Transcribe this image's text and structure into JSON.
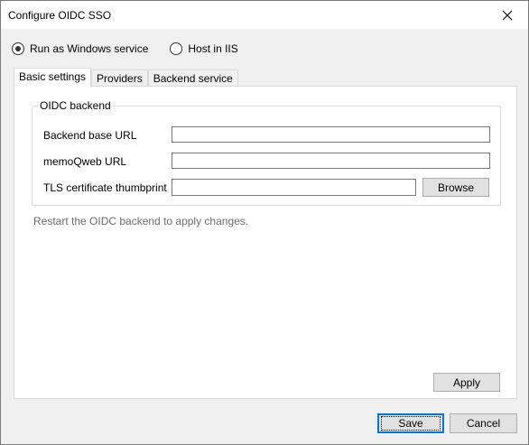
{
  "window": {
    "title": "Configure OIDC SSO"
  },
  "mode": {
    "options": [
      {
        "label": "Run as Windows service",
        "checked": true
      },
      {
        "label": "Host in IIS",
        "checked": false
      }
    ]
  },
  "tabs": [
    {
      "label": "Basic settings",
      "active": true
    },
    {
      "label": "Providers",
      "active": false
    },
    {
      "label": "Backend service",
      "active": false
    }
  ],
  "oidc_backend": {
    "group_title": "OIDC backend",
    "backend_base_url": {
      "label": "Backend base URL",
      "value": ""
    },
    "memoqweb_url": {
      "label": "memoQweb URL",
      "value": ""
    },
    "tls_thumbprint": {
      "label": "TLS certificate thumbprint",
      "value": ""
    },
    "browse_label": "Browse"
  },
  "hint": "Restart the OIDC backend to apply changes.",
  "buttons": {
    "apply": "Apply",
    "save": "Save",
    "cancel": "Cancel"
  }
}
